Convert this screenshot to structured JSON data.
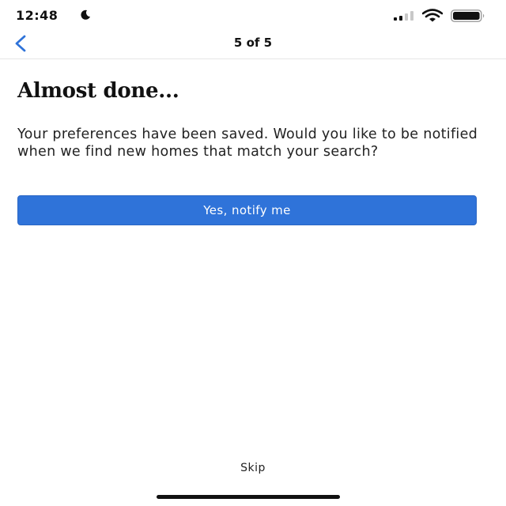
{
  "status_bar": {
    "time": "12:48",
    "icons": [
      "moon-icon",
      "cellular-signal-icon",
      "wifi-icon",
      "battery-icon"
    ]
  },
  "header": {
    "back_icon": "chevron-left-icon",
    "step": "5 of 5"
  },
  "main": {
    "title": "Almost done...",
    "message": "Your preferences have been saved. Would you like to be notified when we find new homes that match your search?",
    "primary_button": "Yes, notify me"
  },
  "footer": {
    "skip_label": "Skip"
  },
  "colors": {
    "accent": "#2f73d9",
    "back_arrow": "#2f73d9",
    "text": "#111111",
    "background": "#ffffff"
  }
}
